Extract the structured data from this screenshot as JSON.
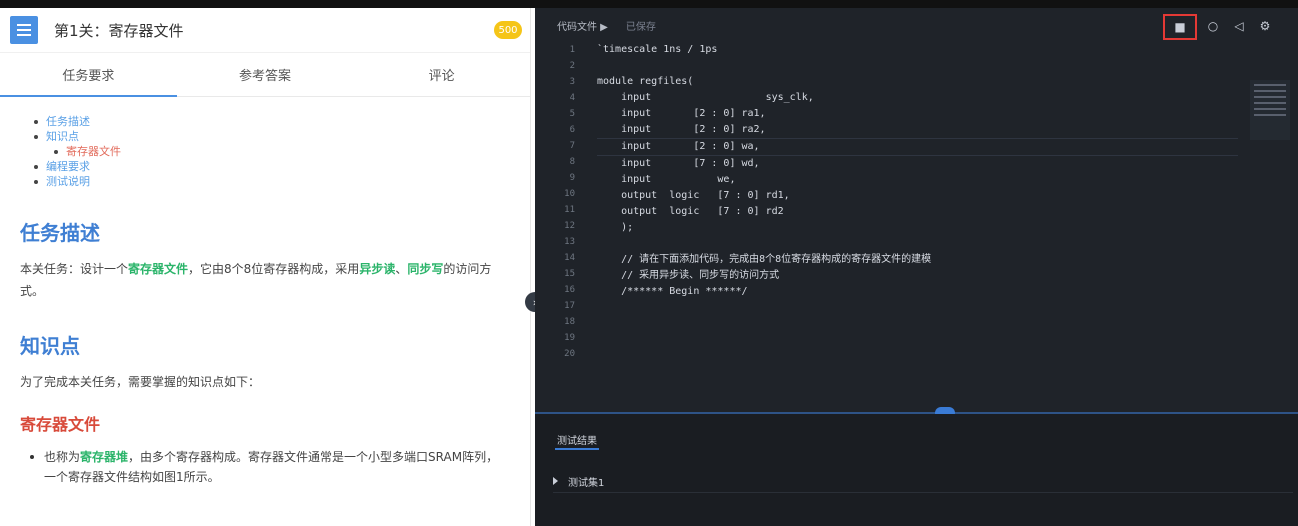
{
  "left": {
    "title": "第1关：寄存器文件",
    "badge": "500",
    "tabs": [
      {
        "label": "任务要求",
        "active": true
      },
      {
        "label": "参考答案",
        "active": false
      },
      {
        "label": "评论",
        "active": false
      }
    ],
    "toc": [
      {
        "label": "任务描述",
        "level": 1
      },
      {
        "label": "知识点",
        "level": 1
      },
      {
        "label": "寄存器文件",
        "level": 2
      },
      {
        "label": "编程要求",
        "level": 1
      },
      {
        "label": "测试说明",
        "level": 1
      }
    ],
    "sections": {
      "task_title": "任务描述",
      "task_para_pre": "本关任务：设计一个",
      "task_para_hl1": "寄存器文件",
      "task_para_mid": "，它由8个8位寄存器构成，采用",
      "task_para_hl2": "异步读",
      "task_para_sep": "、",
      "task_para_hl3": "同步写",
      "task_para_post": "的访问方式。",
      "knowledge_title": "知识点",
      "knowledge_para": "为了完成本关任务，需要掌握的知识点如下：",
      "regfile_title": "寄存器文件",
      "bullet_pre": "也称为",
      "bullet_hl": "寄存器堆",
      "bullet_post": "，由多个寄存器构成。寄存器文件通常是一个小型多端口SRAM阵列，一个寄存器文件结构如图1所示。"
    }
  },
  "right": {
    "tabs": [
      "代码文件 ▶",
      "已保存"
    ],
    "code_lines": [
      "`timescale 1ns / 1ps",
      "",
      "module regfiles(",
      "    input                   sys_clk,",
      "    input       [2 : 0] ra1,",
      "    input       [2 : 0] ra2,",
      "    input       [2 : 0] wa,",
      "    input       [7 : 0] wd,",
      "    input           we,",
      "    output  logic   [7 : 0] rd1,",
      "    output  logic   [7 : 0] rd2",
      "    );",
      "",
      "    // 请在下面添加代码，完成由8个8位寄存器构成的寄存器文件的建模",
      "    // 采用异步读、同步写的访问方式",
      "    /****** Begin ******/",
      "",
      "",
      "",
      ""
    ],
    "line_numbers": [
      "1",
      "2",
      "3",
      "4",
      "5",
      "6",
      "7",
      "8",
      "9",
      "10",
      "11",
      "12",
      "13",
      "14",
      "15",
      "16",
      "17",
      "18",
      "19",
      "20"
    ],
    "current_line": 7,
    "results_header": "测试结果",
    "results_row": "测试集1",
    "icons": [
      "folder-icon",
      "refresh-icon",
      "back-icon",
      "settings-icon"
    ],
    "colors": {
      "accent": "#3a7bd5",
      "editor_bg": "#1f2329",
      "highlight_box": "#e53935"
    }
  }
}
